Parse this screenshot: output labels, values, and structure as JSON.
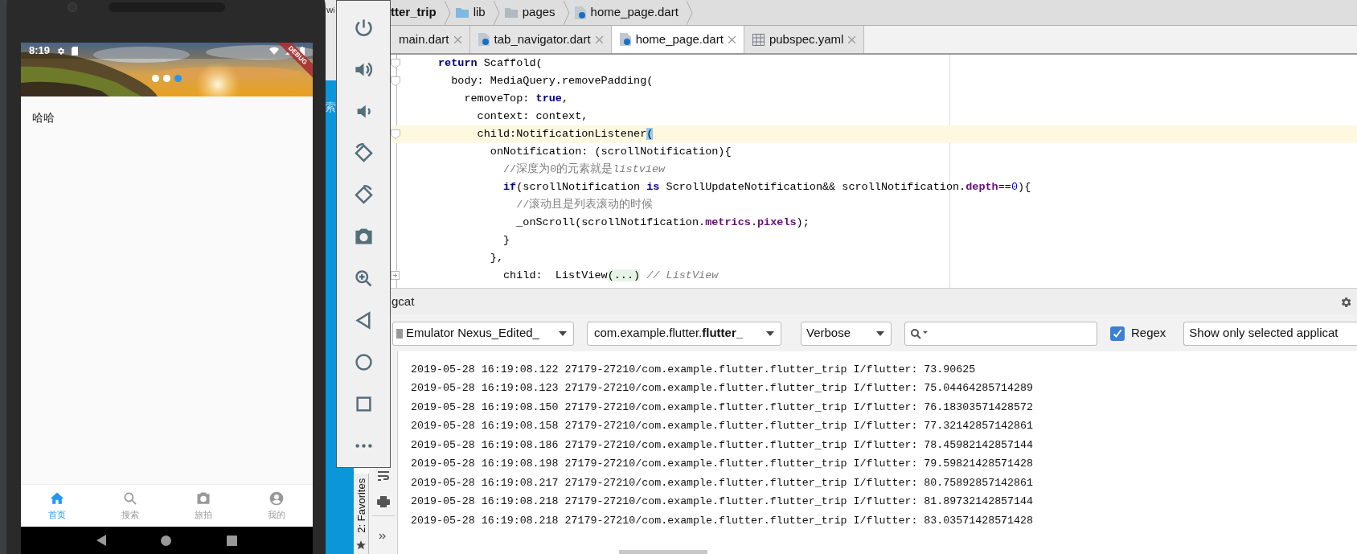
{
  "phone": {
    "status_bar": {
      "time": "8:19"
    },
    "debug_ribbon": "DEBUG",
    "banner": {
      "kind": "picture",
      "dots": [
        {
          "selected": false
        },
        {
          "selected": false
        },
        {
          "selected": true
        }
      ]
    },
    "content": "哈哈",
    "bottom_nav": [
      {
        "label": "首页",
        "selected": true
      },
      {
        "label": "搜索",
        "selected": false
      },
      {
        "label": "旅拍",
        "selected": false
      },
      {
        "label": "我的",
        "selected": false
      }
    ]
  },
  "background_fragments": [
    "Wi",
    "索"
  ],
  "editor": {
    "breadcrumb": [
      "tter_trip",
      "lib",
      "pages",
      "home_page.dart"
    ],
    "tabs": [
      {
        "label": "main.dart",
        "selected": false
      },
      {
        "label": "tab_navigator.dart",
        "selected": false
      },
      {
        "label": "home_page.dart",
        "selected": true
      },
      {
        "label": "pubspec.yaml",
        "selected": false
      }
    ],
    "code_lines": [
      {
        "current": false,
        "segments": [
          {
            "kind": "keyword",
            "text": "return"
          },
          {
            "kind": "plain",
            "text": " Scaffold("
          }
        ]
      },
      {
        "current": false,
        "segments": [
          {
            "kind": "plain",
            "text": "  body: MediaQuery.removePadding("
          }
        ]
      },
      {
        "current": false,
        "segments": [
          {
            "kind": "plain",
            "text": "    removeTop: "
          },
          {
            "kind": "keyword",
            "text": "true"
          },
          {
            "kind": "plain",
            "text": ","
          }
        ]
      },
      {
        "current": false,
        "segments": [
          {
            "kind": "plain",
            "text": "      context: context,"
          }
        ]
      },
      {
        "current": true,
        "segments": [
          {
            "kind": "plain",
            "text": "      child:NotificationListener"
          },
          {
            "kind": "bracket",
            "text": "("
          }
        ]
      },
      {
        "current": false,
        "segments": [
          {
            "kind": "plain",
            "text": "        onNotification: (scrollNotification){"
          }
        ]
      },
      {
        "current": false,
        "segments": [
          {
            "kind": "comment",
            "text": "          //深度为0的元素就是"
          },
          {
            "kind": "comment_italic",
            "text": "listview"
          }
        ]
      },
      {
        "current": false,
        "segments": [
          {
            "kind": "keyword",
            "text": "          if"
          },
          {
            "kind": "plain",
            "text": "(scrollNotification "
          },
          {
            "kind": "keyword",
            "text": "is"
          },
          {
            "kind": "plain",
            "text": " ScrollUpdateNotification&& scrollNotification."
          },
          {
            "kind": "field",
            "text": "depth"
          },
          {
            "kind": "plain",
            "text": "=="
          },
          {
            "kind": "number",
            "text": "0"
          },
          {
            "kind": "plain",
            "text": "){"
          }
        ]
      },
      {
        "current": false,
        "segments": [
          {
            "kind": "comment",
            "text": "            //滚动且是列表滚动的时候"
          }
        ]
      },
      {
        "current": false,
        "segments": [
          {
            "kind": "plain",
            "text": "            _onScroll(scrollNotification."
          },
          {
            "kind": "field",
            "text": "metrics"
          },
          {
            "kind": "plain",
            "text": "."
          },
          {
            "kind": "field",
            "text": "pixels"
          },
          {
            "kind": "plain",
            "text": ");"
          }
        ]
      },
      {
        "current": false,
        "segments": [
          {
            "kind": "plain",
            "text": "          }"
          }
        ]
      },
      {
        "current": false,
        "segments": [
          {
            "kind": "plain",
            "text": "        },"
          }
        ]
      },
      {
        "current": false,
        "segments": [
          {
            "kind": "plain",
            "text": "          child:  ListView"
          },
          {
            "kind": "folded",
            "text": "(...)"
          },
          {
            "kind": "comment_italic",
            "text": " // ListView"
          }
        ]
      }
    ]
  },
  "logcat": {
    "title": "gcat",
    "device": "Emulator Nexus_Edited_",
    "process": "com.example.flutter.**flutter_**",
    "level": "Verbose",
    "regex": {
      "label": "Regex",
      "checked": true
    },
    "filter": "Show only selected applicat",
    "favorites_tab": "2: Favorites",
    "lines": [
      "2019-05-28 16:19:08.122 27179-27210/com.example.flutter.flutter_trip I/flutter: 73.90625",
      "2019-05-28 16:19:08.123 27179-27210/com.example.flutter.flutter_trip I/flutter: 75.04464285714289",
      "2019-05-28 16:19:08.150 27179-27210/com.example.flutter.flutter_trip I/flutter: 76.18303571428572",
      "2019-05-28 16:19:08.158 27179-27210/com.example.flutter.flutter_trip I/flutter: 77.32142857142861",
      "2019-05-28 16:19:08.186 27179-27210/com.example.flutter.flutter_trip I/flutter: 78.45982142857144",
      "2019-05-28 16:19:08.198 27179-27210/com.example.flutter.flutter_trip I/flutter: 79.59821428571428",
      "2019-05-28 16:19:08.217 27179-27210/com.example.flutter.flutter_trip I/flutter: 80.75892857142861",
      "2019-05-28 16:19:08.218 27179-27210/com.example.flutter.flutter_trip I/flutter: 81.89732142857144",
      "2019-05-28 16:19:08.218 27179-27210/com.example.flutter.flutter_trip I/flutter: 83.03571428571428"
    ]
  }
}
